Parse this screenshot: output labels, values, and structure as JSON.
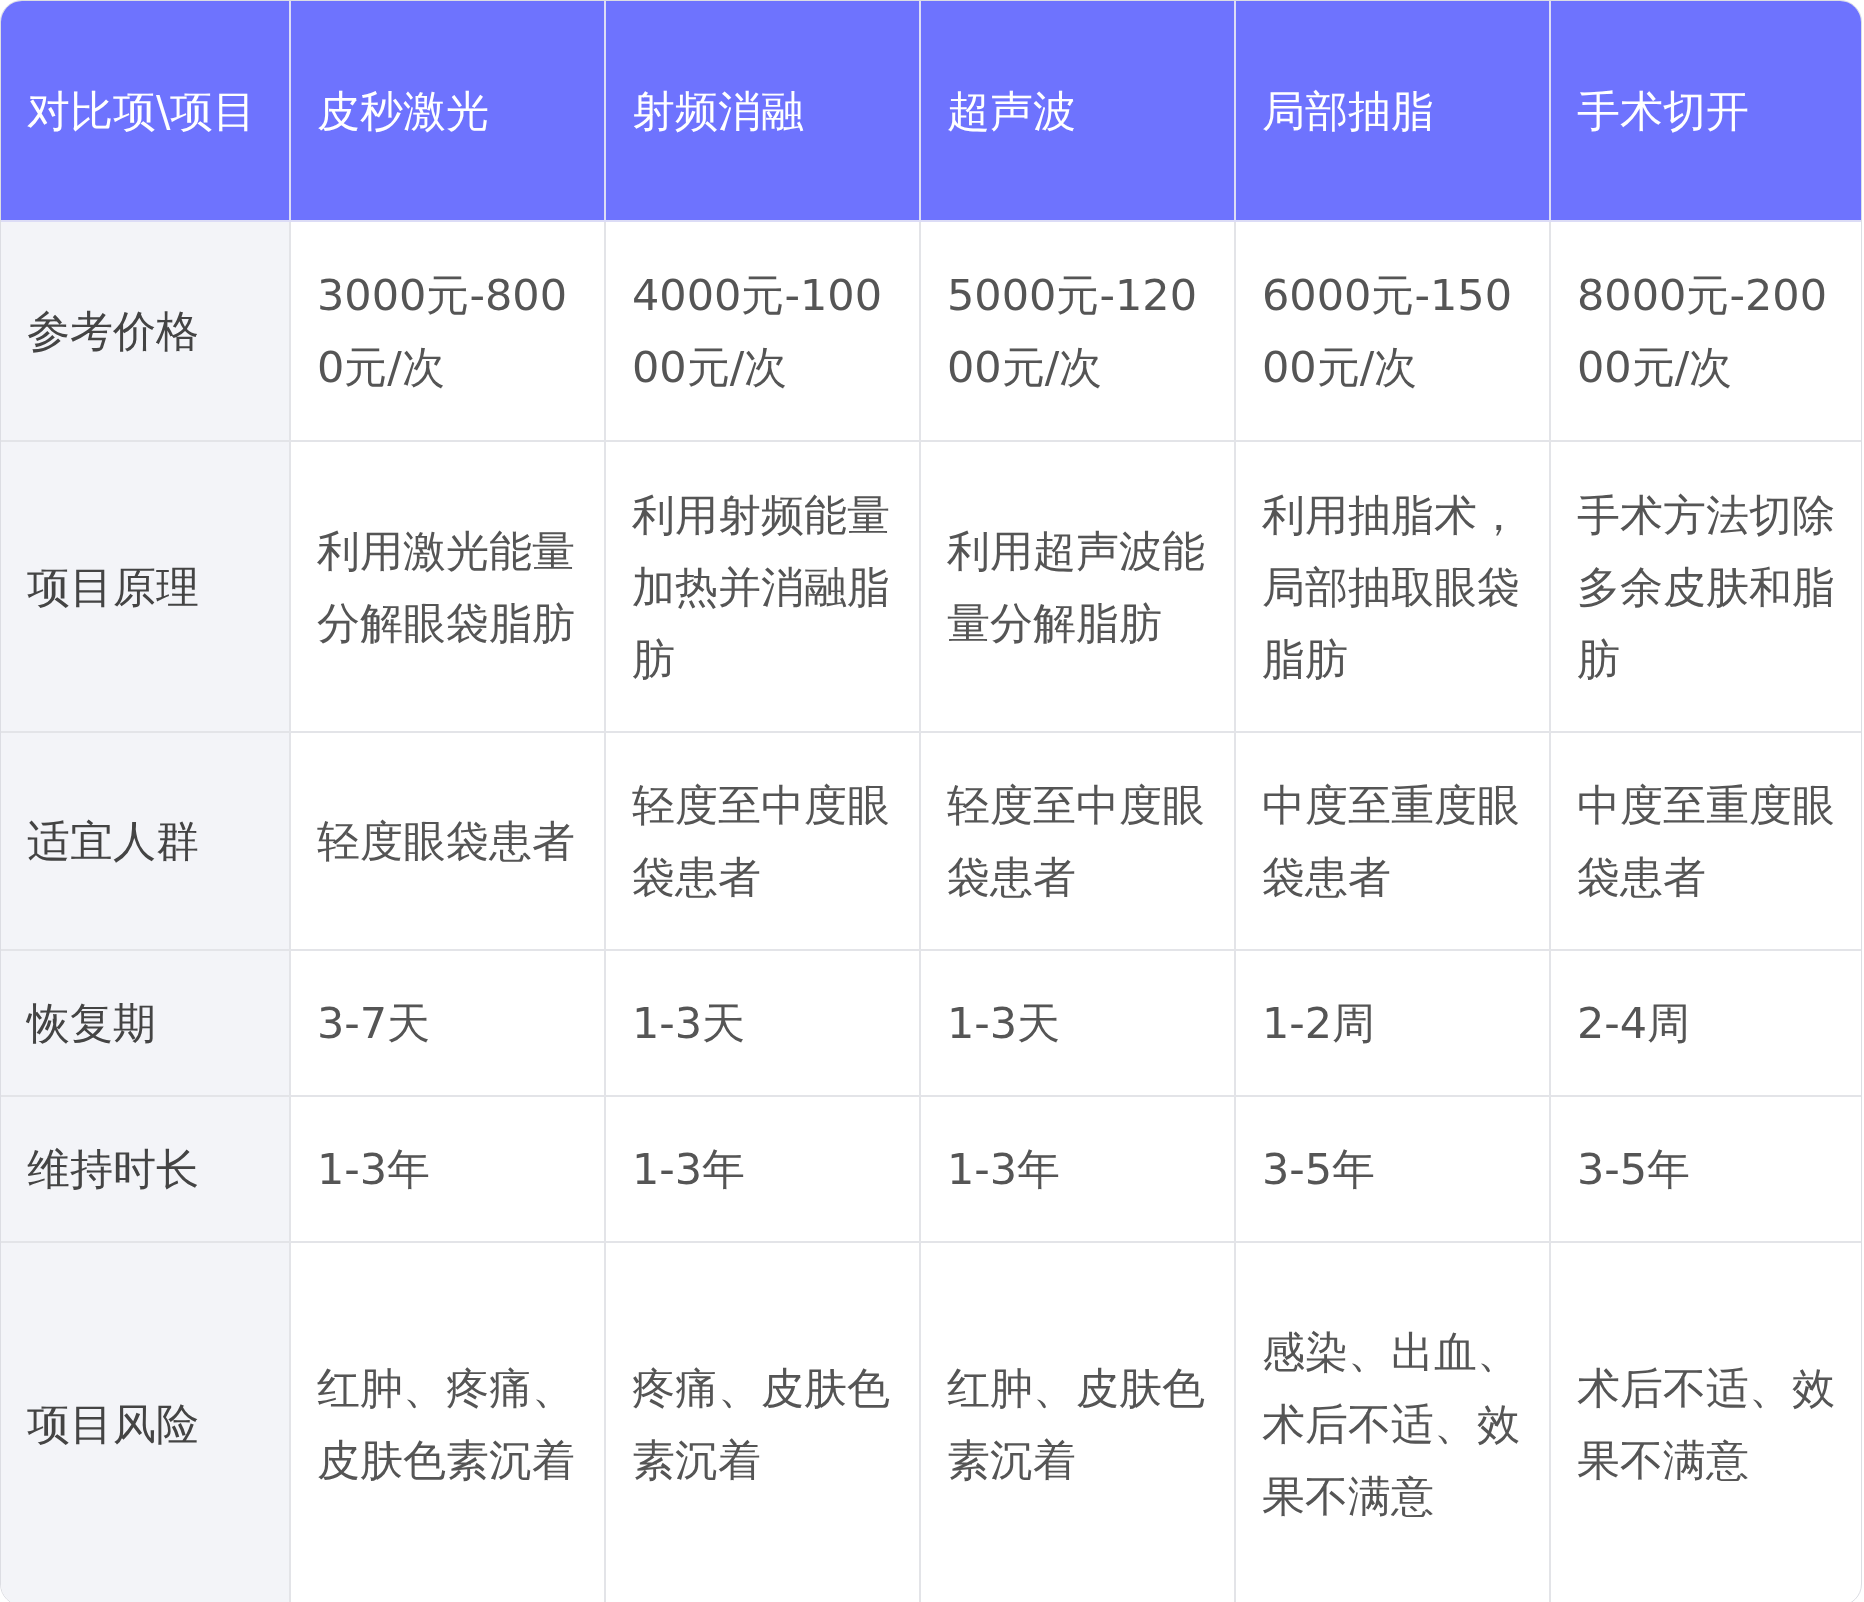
{
  "table": {
    "columns": [
      "对比项\\项目",
      "皮秒激光",
      "射频消融",
      "超声波",
      "局部抽脂",
      "手术切开"
    ],
    "rows": [
      [
        "参考价格",
        "3000元-8000元/次",
        "4000元-10000元/次",
        "5000元-12000元/次",
        "6000元-15000元/次",
        "8000元-20000元/次"
      ],
      [
        "项目原理",
        "利用激光能量分解眼袋脂肪",
        "利用射频能量加热并消融脂肪",
        "利用超声波能量分解脂肪",
        "利用抽脂术，局部抽取眼袋脂肪",
        "手术方法切除多余皮肤和脂肪"
      ],
      [
        "适宜人群",
        "轻度眼袋患者",
        "轻度至中度眼袋患者",
        "轻度至中度眼袋患者",
        "中度至重度眼袋患者",
        "中度至重度眼袋患者"
      ],
      [
        "恢复期",
        "3-7天",
        "1-3天",
        "1-3天",
        "1-2周",
        "2-4周"
      ],
      [
        "维持时长",
        "1-3年",
        "1-3年",
        "1-3年",
        "3-5年",
        "3-5年"
      ],
      [
        "项目风险",
        "红肿、疼痛、皮肤色素沉着",
        "疼痛、皮肤色素沉着",
        "红肿、皮肤色素沉着",
        "感染、出血、术后不适、效果不满意",
        "术后不适、效果不满意"
      ]
    ]
  }
}
